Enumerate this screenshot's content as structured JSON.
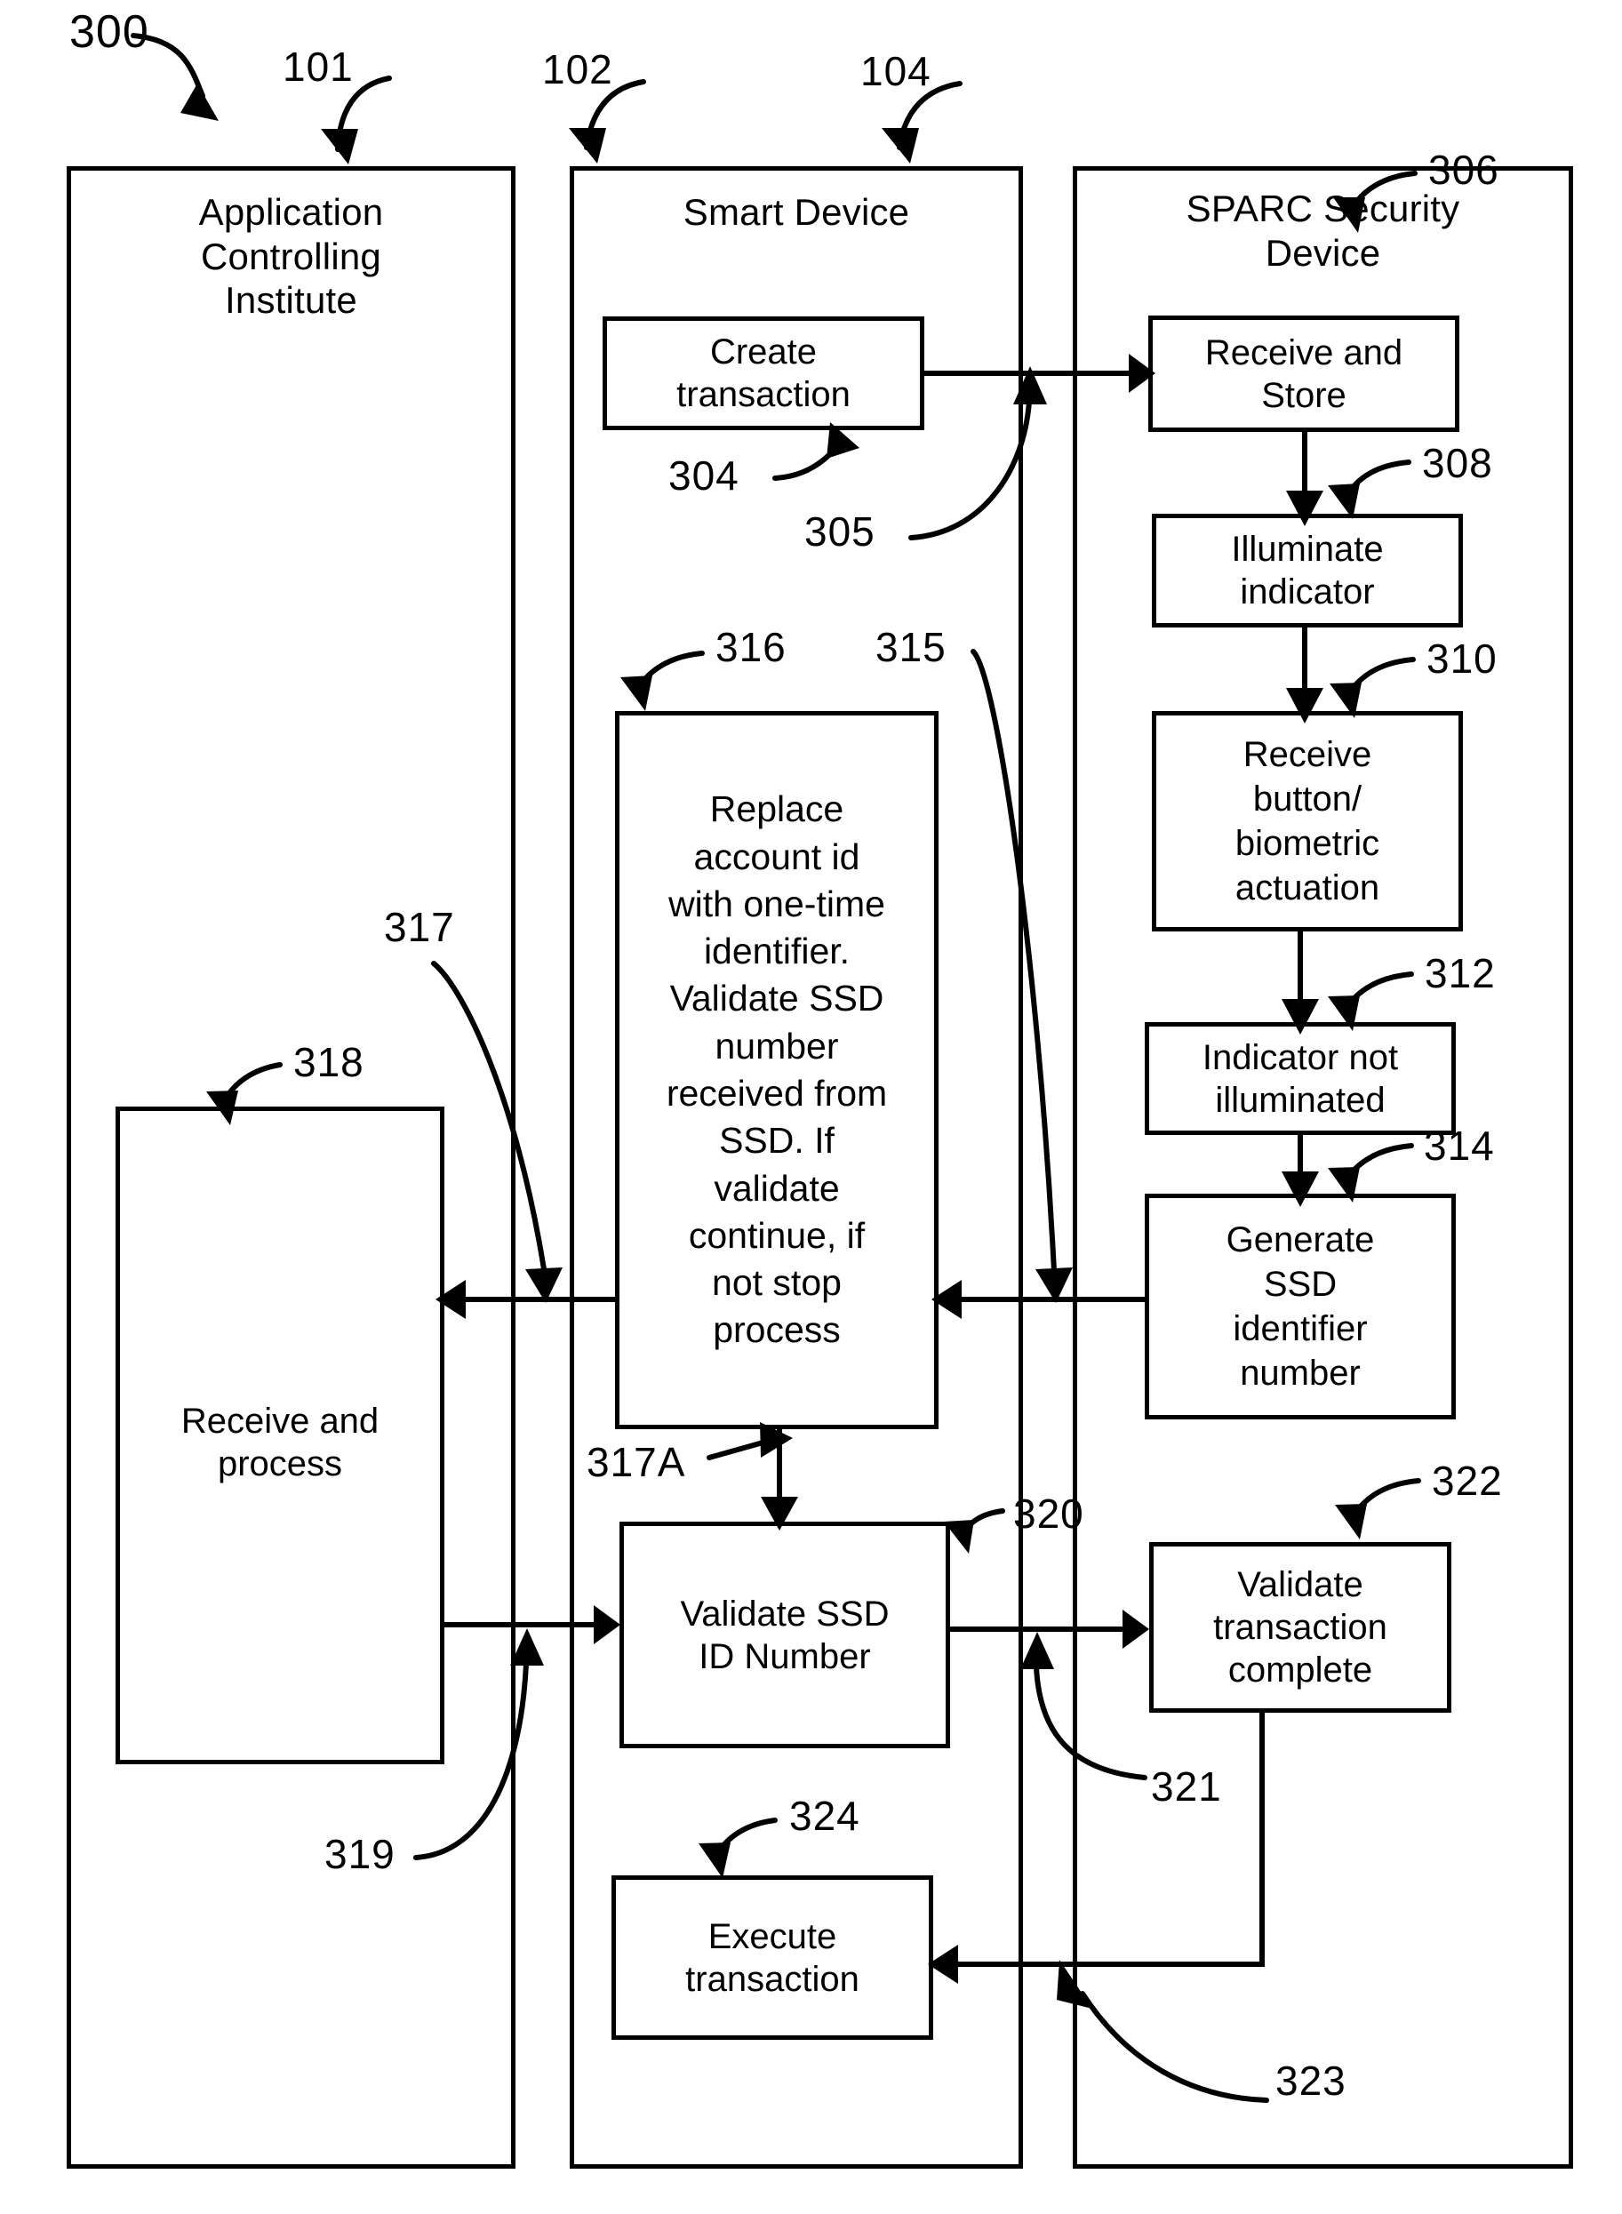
{
  "figure": {
    "number": "300",
    "type": "patent-flow-diagram"
  },
  "lanes": [
    {
      "id": "acquirer",
      "title": "Application\nControlling\nInstitute",
      "ref": "101"
    },
    {
      "id": "smart",
      "title": "Smart Device",
      "ref": "102"
    },
    {
      "id": "sparc",
      "title": "SPARC Security\nDevice",
      "ref": "104"
    }
  ],
  "boxes": [
    {
      "id": "create-transaction",
      "lane": "smart",
      "ref": "304",
      "label": "Create\ntransaction"
    },
    {
      "id": "receive-and-store",
      "lane": "sparc",
      "ref": "306",
      "label": "Receive and\nStore"
    },
    {
      "id": "illuminate-indicator",
      "lane": "sparc",
      "ref": "308",
      "label": "Illuminate\nindicator"
    },
    {
      "id": "receive-actuation",
      "lane": "sparc",
      "ref": "310",
      "label": "Receive\nbutton/\nbiometric\nactuation"
    },
    {
      "id": "indicator-not-illum",
      "lane": "sparc",
      "ref": "312",
      "label": "Indicator not\nilluminated"
    },
    {
      "id": "generate-ssd-id",
      "lane": "sparc",
      "ref": "314",
      "label": "Generate\nSSD\nidentifier\nnumber"
    },
    {
      "id": "replace-account-id",
      "lane": "smart",
      "ref": "316",
      "label": "Replace\naccount id\nwith one-time\nidentifier.\nValidate SSD\nnumber\nreceived from\nSSD.  If\nvalidate\ncontinue, if\nnot stop\nprocess"
    },
    {
      "id": "receive-and-process",
      "lane": "acquirer",
      "ref": "318",
      "label": "Receive and\nprocess"
    },
    {
      "id": "validate-ssd-id-number",
      "lane": "smart",
      "ref": "320",
      "label": "Validate SSD\nID Number"
    },
    {
      "id": "validate-txn-complete",
      "lane": "sparc",
      "ref": "322",
      "label": "Validate\ntransaction\ncomplete"
    },
    {
      "id": "execute-transaction",
      "lane": "smart",
      "ref": "324",
      "label": "Execute\ntransaction"
    }
  ],
  "flow_refs": [
    {
      "id": "flow-305",
      "label": "305"
    },
    {
      "id": "flow-315",
      "label": "315"
    },
    {
      "id": "flow-317",
      "label": "317"
    },
    {
      "id": "flow-317a",
      "label": "317A"
    },
    {
      "id": "flow-319",
      "label": "319"
    },
    {
      "id": "flow-321",
      "label": "321"
    },
    {
      "id": "flow-323",
      "label": "323"
    }
  ],
  "colors": {
    "ink": "#000000",
    "paper": "#ffffff"
  }
}
